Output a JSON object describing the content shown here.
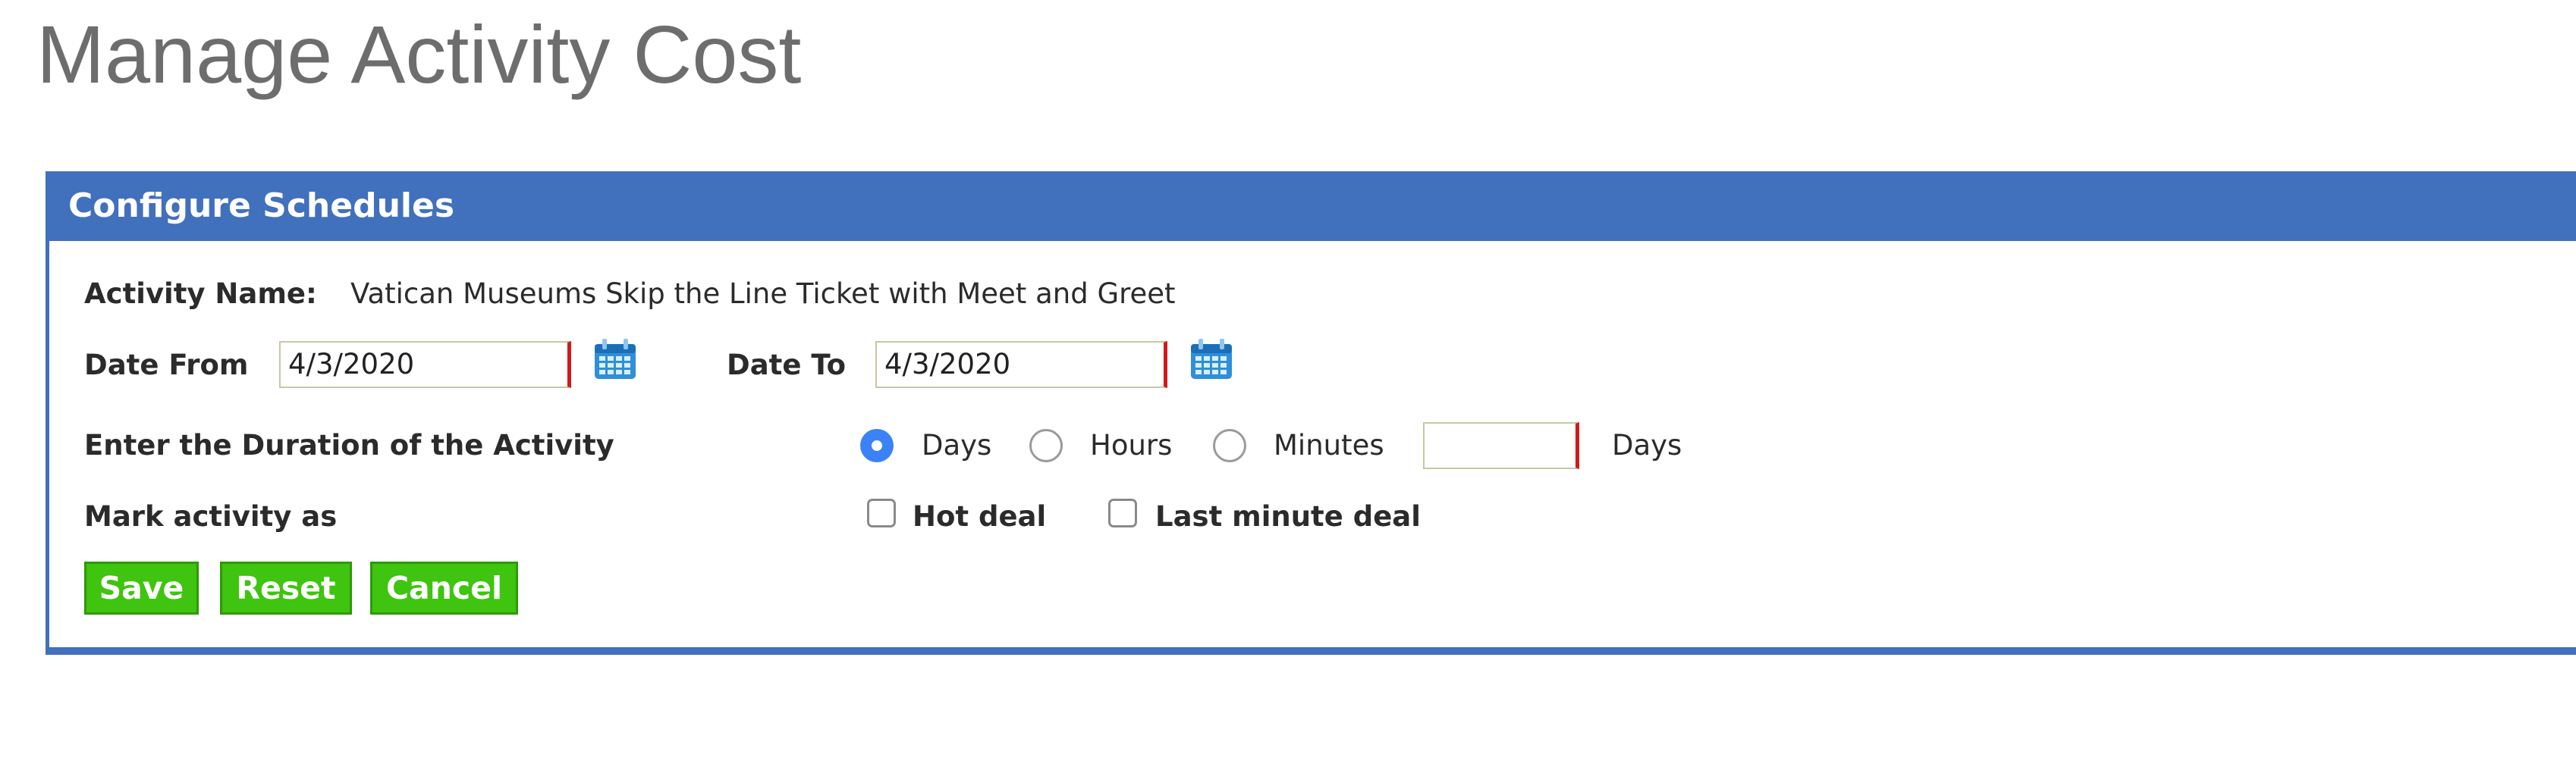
{
  "page": {
    "title": "Manage Activity Cost"
  },
  "panel": {
    "title": "Configure Schedules"
  },
  "activity": {
    "label": "Activity Name:",
    "value": "Vatican Museums Skip the Line Ticket with Meet and Greet"
  },
  "date_from": {
    "label": "Date From",
    "value": "4/3/2020",
    "icon": "calendar-icon"
  },
  "date_to": {
    "label": "Date To",
    "value": "4/3/2020",
    "icon": "calendar-icon"
  },
  "duration": {
    "label": "Enter the Duration of the Activity",
    "options": [
      {
        "label": "Days",
        "checked": true
      },
      {
        "label": "Hours",
        "checked": false
      },
      {
        "label": "Minutes",
        "checked": false
      }
    ],
    "value": "",
    "unit_label": "Days"
  },
  "mark": {
    "label": "Mark activity as",
    "options": [
      {
        "label": "Hot deal",
        "checked": false
      },
      {
        "label": "Last minute deal",
        "checked": false
      }
    ]
  },
  "buttons": {
    "save": "Save",
    "reset": "Reset",
    "cancel": "Cancel"
  },
  "colors": {
    "header": "#4170bc",
    "button": "#3fc40f",
    "required_marker": "#d11a1a",
    "radio_selected": "#3b82f6"
  }
}
